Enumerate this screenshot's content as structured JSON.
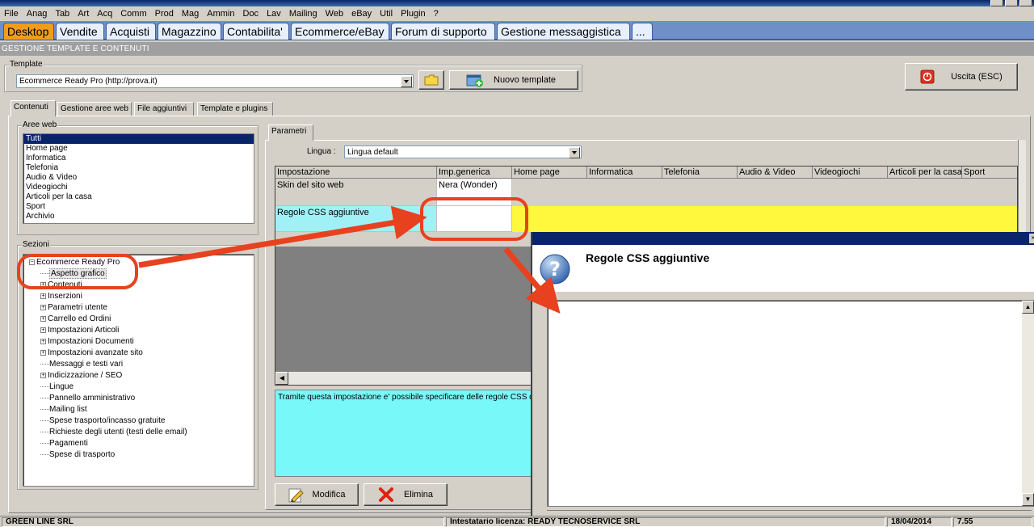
{
  "menu": [
    "File",
    "Anag",
    "Tab",
    "Art",
    "Acq",
    "Comm",
    "Prod",
    "Mag",
    "Ammin",
    "Doc",
    "Lav",
    "Mailing",
    "Web",
    "eBay",
    "Util",
    "Plugin",
    "?"
  ],
  "main_tabs": [
    "Desktop",
    "Vendite",
    "Acquisti",
    "Magazzino",
    "Contabilita'",
    "Ecommerce/eBay",
    "Forum di supporto",
    "Gestione messaggistica",
    "..."
  ],
  "section_title": "GESTIONE TEMPLATE E CONTENUTI",
  "template": {
    "group_label": "Template",
    "selected": "Ecommerce Ready Pro (http://prova.it)",
    "new_button": "Nuovo template"
  },
  "exit_button": "Uscita (ESC)",
  "sub_tabs": [
    "Contenuti",
    "Gestione aree web",
    "File aggiuntivi",
    "Template e plugins"
  ],
  "aree_web": {
    "label": "Aree web",
    "items": [
      "Tutti",
      "Home page",
      "Informatica",
      "Telefonia",
      "Audio & Video",
      "Videogiochi",
      "Articoli per la casa",
      "Sport",
      "Archivio"
    ]
  },
  "sezioni": {
    "label": "Sezioni",
    "root": "Ecommerce Ready Pro",
    "items": [
      {
        "label": "Aspetto grafico",
        "exp": false
      },
      {
        "label": "Contenuti",
        "exp": true
      },
      {
        "label": "Inserzioni",
        "exp": true
      },
      {
        "label": "Parametri utente",
        "exp": true
      },
      {
        "label": "Carrello ed Ordini",
        "exp": true
      },
      {
        "label": "Impostazioni Articoli",
        "exp": true
      },
      {
        "label": "Impostazioni Documenti",
        "exp": true
      },
      {
        "label": "Impostazioni avanzate sito",
        "exp": true
      },
      {
        "label": "Messaggi e testi vari",
        "exp": false
      },
      {
        "label": "Indicizzazione / SEO",
        "exp": true
      },
      {
        "label": "Lingue",
        "exp": false
      },
      {
        "label": "Pannello amministrativo",
        "exp": false
      },
      {
        "label": "Mailing list",
        "exp": false
      },
      {
        "label": "Spese trasporto/incasso gratuite",
        "exp": false
      },
      {
        "label": "Richieste degli utenti (testi delle email)",
        "exp": false
      },
      {
        "label": "Pagamenti",
        "exp": false
      },
      {
        "label": "Spese di trasporto",
        "exp": false
      }
    ]
  },
  "parametri": {
    "tab": "Parametri",
    "lingua_label": "Lingua :",
    "lingua_value": "Lingua default",
    "columns": [
      "Impostazione",
      "Imp.generica",
      "Home page",
      "Informatica",
      "Telefonia",
      "Audio & Video",
      "Videogiochi",
      "Articoli per la casa",
      "Sport"
    ],
    "rows": [
      {
        "name": "Skin del sito web",
        "generic": "Nera (Wonder)"
      },
      {
        "name": "Regole CSS aggiuntive",
        "generic": ""
      }
    ],
    "description": "Tramite questa impostazione e' possibile specificare delle regole CSS da",
    "modifica": "Modifica",
    "elimina": "Elimina"
  },
  "dialog": {
    "title": "Regole CSS aggiuntive",
    "text": ""
  },
  "status": {
    "company": "GREEN LINE SRL",
    "licensee": "Intestatario licenza: READY TECNOSERVICE SRL",
    "date": "18/04/2014",
    "version": "7.55"
  },
  "colors": {
    "tab_active": "#f39c1c",
    "tabbar": "#6f8fc8",
    "highlight_row": "#fff83c",
    "description_bg": "#78f8f8",
    "annotation": "#e8411f",
    "dialog_header": "#0a246a"
  }
}
